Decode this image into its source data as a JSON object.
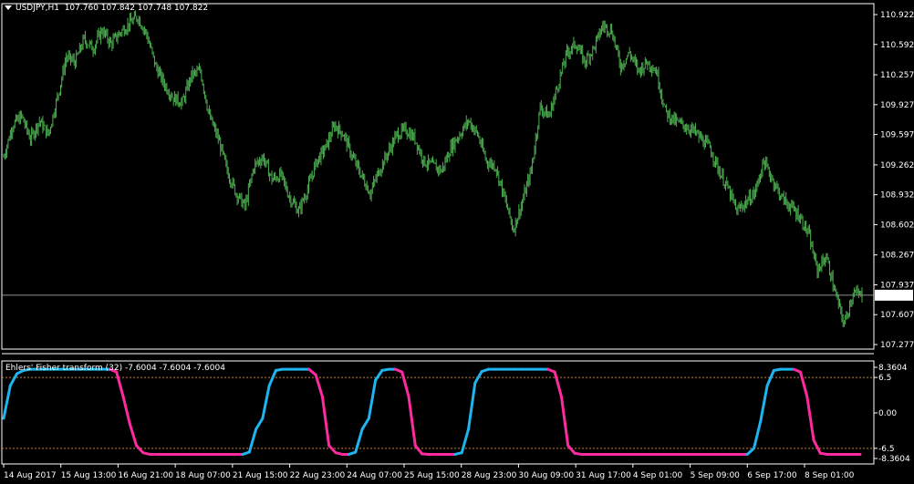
{
  "header": {
    "symbol": "USDJPY,H1",
    "ohlc": "107.760 107.842 107.748 107.822"
  },
  "indicator": {
    "title": "Ehlers' Fisher transform (32) -7.6004 -7.6004 -7.6004"
  },
  "colors": {
    "background": "#000000",
    "price_bars": "#4caf50",
    "axis": "#ffffff",
    "current_price_line": "#c0c0c0",
    "level_lines": "#d08030",
    "fisher_up": "#1eb4f0",
    "fisher_down": "#ff2aa0"
  },
  "chart_data": [
    {
      "type": "line",
      "title": "USDJPY,H1",
      "y_ticks": [
        "110.922",
        "110.592",
        "110.257",
        "109.927",
        "109.597",
        "109.262",
        "108.932",
        "108.602",
        "108.267",
        "107.937",
        "107.607",
        "107.277"
      ],
      "ylim": [
        107.277,
        110.922
      ],
      "current_price": "107.822",
      "x_ticks": [
        "14 Aug 2017",
        "15 Aug 13:00",
        "16 Aug 21:00",
        "18 Aug 07:00",
        "21 Aug 15:00",
        "22 Aug 23:00",
        "24 Aug 07:00",
        "25 Aug 15:00",
        "28 Aug 23:00",
        "30 Aug 09:00",
        "31 Aug 17:00",
        "4 Sep 01:00",
        "5 Sep 09:00",
        "6 Sep 17:00",
        "8 Sep 01:00"
      ],
      "series": [
        {
          "values": [
            109.35,
            109.7,
            109.8,
            109.55,
            109.75,
            109.6,
            110.0,
            110.45,
            110.4,
            110.65,
            110.55,
            110.75,
            110.6,
            110.72,
            110.82,
            110.9,
            110.7,
            110.35,
            110.15,
            110.0,
            109.95,
            110.25,
            110.3,
            109.8,
            109.55,
            109.2,
            108.95,
            108.8,
            109.25,
            109.35,
            109.1,
            109.15,
            108.9,
            108.75,
            109.0,
            109.3,
            109.45,
            109.7,
            109.6,
            109.35,
            109.15,
            108.95,
            109.2,
            109.4,
            109.6,
            109.65,
            109.55,
            109.3,
            109.25,
            109.2,
            109.45,
            109.6,
            109.75,
            109.6,
            109.3,
            109.25,
            108.9,
            108.55,
            108.85,
            109.2,
            109.9,
            109.8,
            110.15,
            110.5,
            110.6,
            110.4,
            110.55,
            110.8,
            110.75,
            110.35,
            110.5,
            110.3,
            110.4,
            110.3,
            109.85,
            109.75,
            109.7,
            109.65,
            109.55,
            109.45,
            109.2,
            109.0,
            108.75,
            108.85,
            108.95,
            109.3,
            109.1,
            108.9,
            108.8,
            108.7,
            108.5,
            108.1,
            108.25,
            107.85,
            107.5,
            107.85,
            107.82
          ]
        }
      ]
    },
    {
      "type": "line",
      "title": "Ehlers' Fisher transform (32) -7.6004 -7.6004 -7.6004",
      "y_ticks": [
        "8.3604",
        "6.5",
        "0.00",
        "-6.5",
        "-8.3604"
      ],
      "ylim": [
        -8.3604,
        8.3604
      ],
      "levels": [
        6.5,
        -6.5
      ],
      "series": [
        {
          "values": [
            -1.0,
            5.0,
            7.2,
            7.8,
            8.0,
            8.0,
            8.0,
            8.0,
            8.0,
            8.0,
            8.0,
            8.0,
            8.0,
            8.0,
            8.0,
            8.0,
            8.0,
            7.5,
            3.0,
            -2.0,
            -6.0,
            -7.3,
            -7.6,
            -7.6,
            -7.6,
            -7.6,
            -7.6,
            -7.6,
            -7.6,
            -7.6,
            -7.6,
            -7.6,
            -7.6,
            -7.6,
            -7.6,
            -7.6,
            -7.6,
            -7.2,
            -3.0,
            -1.0,
            5.0,
            7.8,
            8.0,
            8.0,
            8.0,
            8.0,
            8.0,
            7.0,
            3.0,
            -6.0,
            -7.3,
            -7.6,
            -7.6,
            -7.2,
            -3.0,
            -1.0,
            6.0,
            7.8,
            8.0,
            8.0,
            7.5,
            3.0,
            -6.0,
            -7.5,
            -7.6,
            -7.6,
            -7.6,
            -7.6,
            -7.6,
            -7.3,
            -3.0,
            5.5,
            7.6,
            8.0,
            8.0,
            8.0,
            8.0,
            8.0,
            8.0,
            8.0,
            8.0,
            8.0,
            8.0,
            7.5,
            3.0,
            -6.0,
            -7.4,
            -7.6,
            -7.6,
            -7.6,
            -7.6,
            -7.6,
            -7.6,
            -7.6,
            -7.6,
            -7.6,
            -7.6,
            -7.6,
            -7.6,
            -7.6,
            -7.6,
            -7.6,
            -7.6,
            -7.6,
            -7.6,
            -7.6,
            -7.6,
            -7.6,
            -7.6,
            -7.6,
            -7.6,
            -7.6,
            -7.6,
            -6.5,
            -1.5,
            5.0,
            7.8,
            8.0,
            8.0,
            8.0,
            7.5,
            3.0,
            -5.0,
            -7.4,
            -7.6,
            -7.6,
            -7.6,
            -7.6,
            -7.6,
            -7.6
          ]
        }
      ]
    }
  ]
}
